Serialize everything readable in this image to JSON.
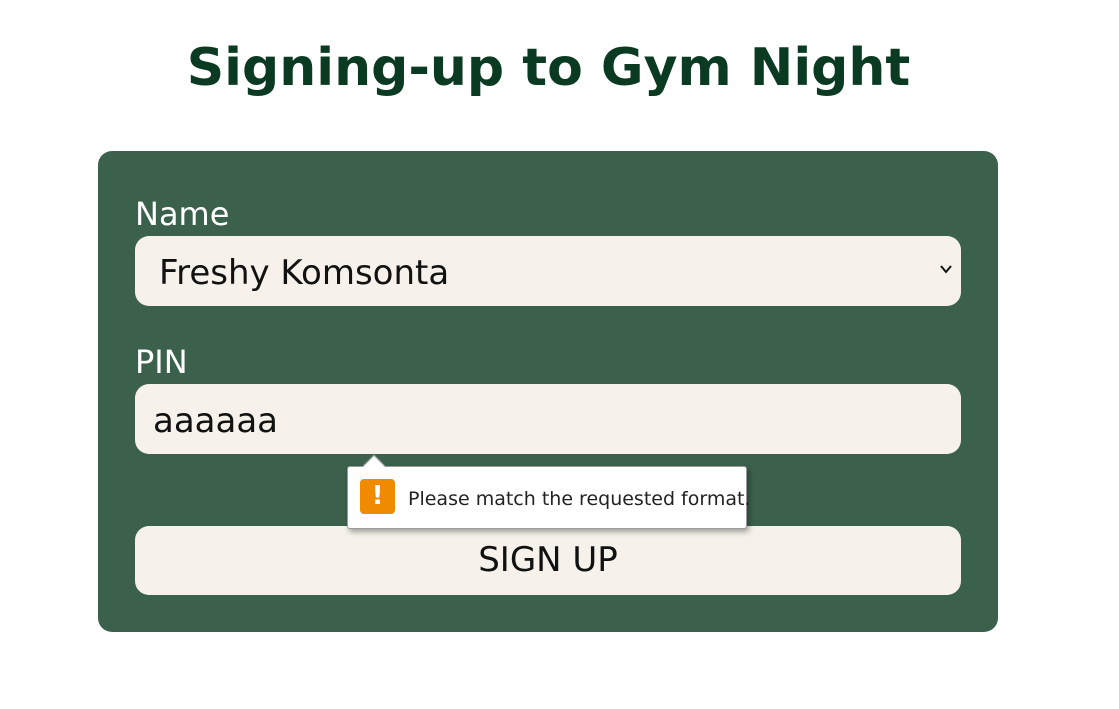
{
  "page": {
    "title": "Signing-up to Gym Night"
  },
  "form": {
    "name_label": "Name",
    "name_select": {
      "selected": "Freshy Komsonta",
      "icon": "chevron-down-icon"
    },
    "pin_label": "PIN",
    "pin_input": {
      "value": "aaaaaa"
    },
    "submit_label": "SIGN UP"
  },
  "validation_tooltip": {
    "icon": "warning-icon",
    "icon_glyph": "!",
    "message": "Please match the requested format."
  },
  "colors": {
    "title": "#0b3a22",
    "card_background": "#3b614c",
    "field_background": "#f6f2eb",
    "warning": "#f08a00"
  }
}
